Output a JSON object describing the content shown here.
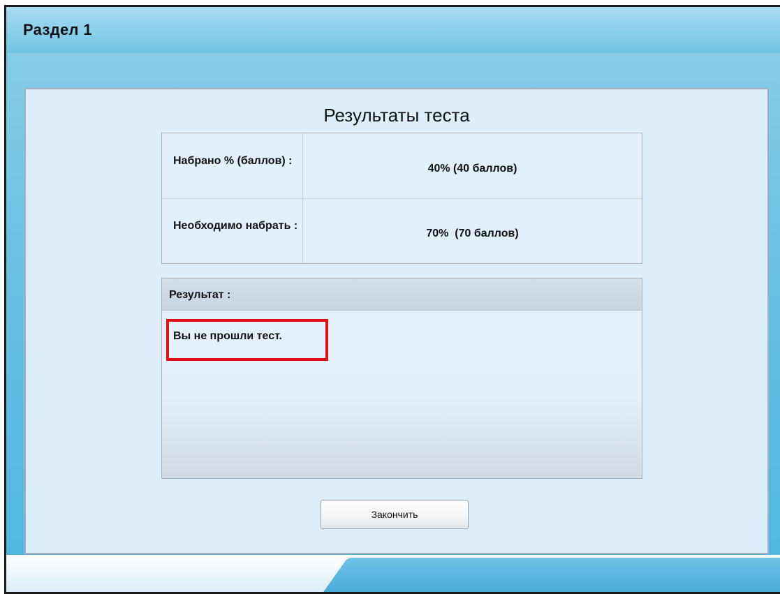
{
  "header": {
    "title": "Раздел 1"
  },
  "results": {
    "title": "Результаты теста",
    "rows": [
      {
        "label": "Набрано % (баллов) :",
        "value": "40% (40 баллов)"
      },
      {
        "label": "Необходимо набрать :",
        "value": "70%  (70 баллов)"
      }
    ],
    "result_label": "Результат :",
    "result_message": "Вы не прошли тест."
  },
  "actions": {
    "finish_label": "Закончить"
  },
  "colors": {
    "header_blue": "#8fd1ec",
    "content_bg": "#ddeefc",
    "highlight_red": "#e01010"
  }
}
